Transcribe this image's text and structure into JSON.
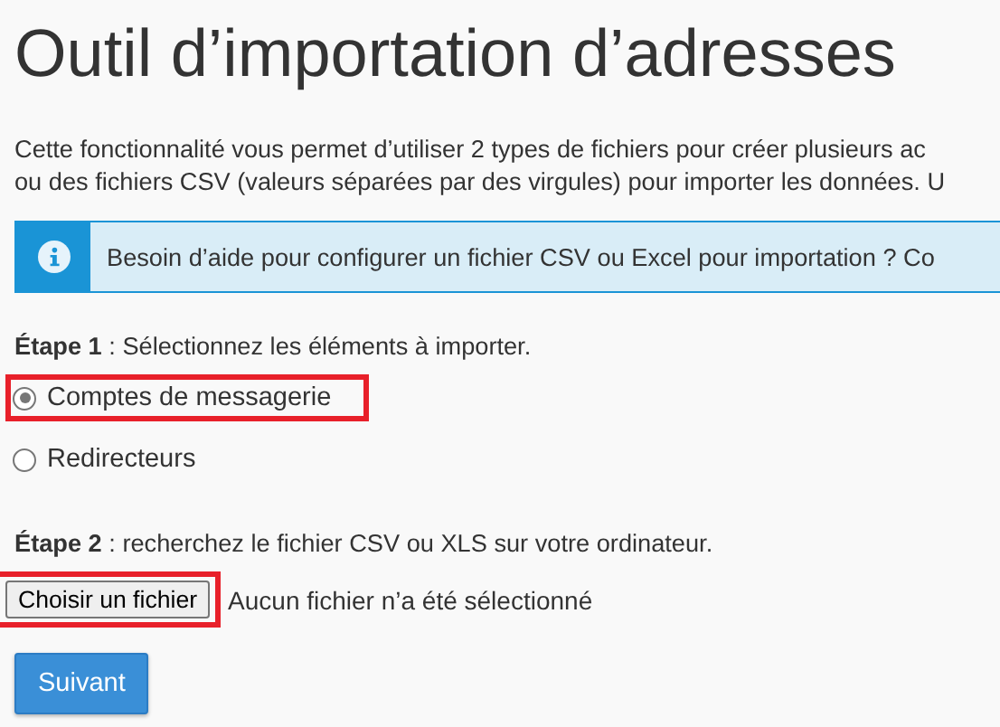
{
  "title": "Outil d’importation d’adresses",
  "intro": [
    "Cette fonctionnalité vous permet d’utiliser 2 types de fichiers pour créer plusieurs ac",
    "ou des fichiers CSV (valeurs séparées par des virgules) pour importer les données. U"
  ],
  "info": {
    "text": "Besoin d’aide pour configurer un fichier CSV ou Excel pour importation ? Co"
  },
  "step1": {
    "label": "Étape 1",
    "text": " : Sélectionnez les éléments à importer."
  },
  "options": [
    {
      "label": "Comptes de messagerie",
      "selected": true,
      "highlighted": true
    },
    {
      "label": "Redirecteurs",
      "selected": false,
      "highlighted": false
    }
  ],
  "step2": {
    "label": "Étape 2",
    "text": " : recherchez le fichier CSV ou XLS sur votre ordinateur."
  },
  "file": {
    "button": "Choisir un fichier",
    "status": "Aucun fichier n’a été sélectionné",
    "highlighted": true
  },
  "submit": "Suivant"
}
